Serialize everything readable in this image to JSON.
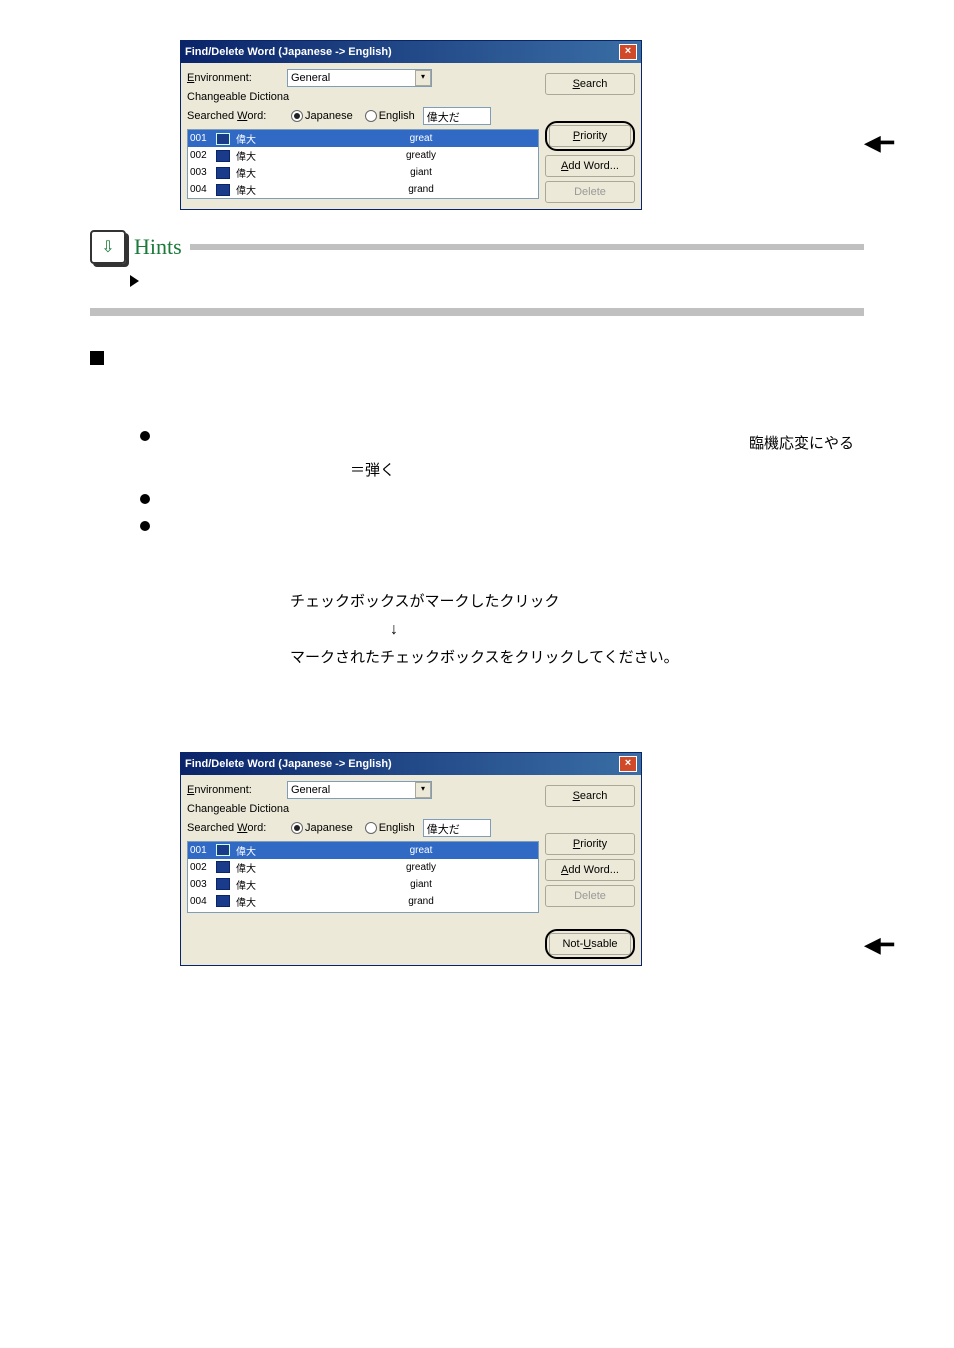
{
  "dialog_top": {
    "title": "Find/Delete Word (Japanese -> English)",
    "env_label": "Environment:",
    "env_value": "General",
    "changeable_label": "Changeable Dictiona",
    "searched_label": "Searched Word:",
    "radio_jp": "Japanese",
    "radio_en": "English",
    "search_value": "偉大だ",
    "buttons": {
      "search": "Search",
      "priority": "Priority",
      "addword": "Add Word...",
      "delete": "Delete"
    },
    "rows": [
      {
        "num": "001",
        "jp": "偉大",
        "en": "great",
        "sel": true
      },
      {
        "num": "002",
        "jp": "偉大",
        "en": "greatly",
        "sel": false
      },
      {
        "num": "003",
        "jp": "偉大",
        "en": "giant",
        "sel": false
      },
      {
        "num": "004",
        "jp": "偉大",
        "en": "grand",
        "sel": false
      }
    ]
  },
  "hints": {
    "title": "Hints"
  },
  "text": {
    "rinki": "臨機応変にやる",
    "hiku": "＝弾く",
    "line1": "チェックボックスがマークしたクリック",
    "arrow": "↓",
    "line2": "マークされたチェックボックスをクリックしてください。"
  },
  "dialog_bottom": {
    "title": "Find/Delete Word (Japanese -> English)",
    "env_label": "Environment:",
    "env_value": "General",
    "changeable_label": "Changeable Dictiona",
    "searched_label": "Searched Word:",
    "radio_jp": "Japanese",
    "radio_en": "English",
    "search_value": "偉大だ",
    "buttons": {
      "search": "Search",
      "priority": "Priority",
      "addword": "Add Word...",
      "delete": "Delete",
      "notusable": "Not-Usable"
    },
    "rows": [
      {
        "num": "001",
        "jp": "偉大",
        "en": "great",
        "sel": true
      },
      {
        "num": "002",
        "jp": "偉大",
        "en": "greatly",
        "sel": false
      },
      {
        "num": "003",
        "jp": "偉大",
        "en": "giant",
        "sel": false
      },
      {
        "num": "004",
        "jp": "偉大",
        "en": "grand",
        "sel": false
      }
    ]
  }
}
